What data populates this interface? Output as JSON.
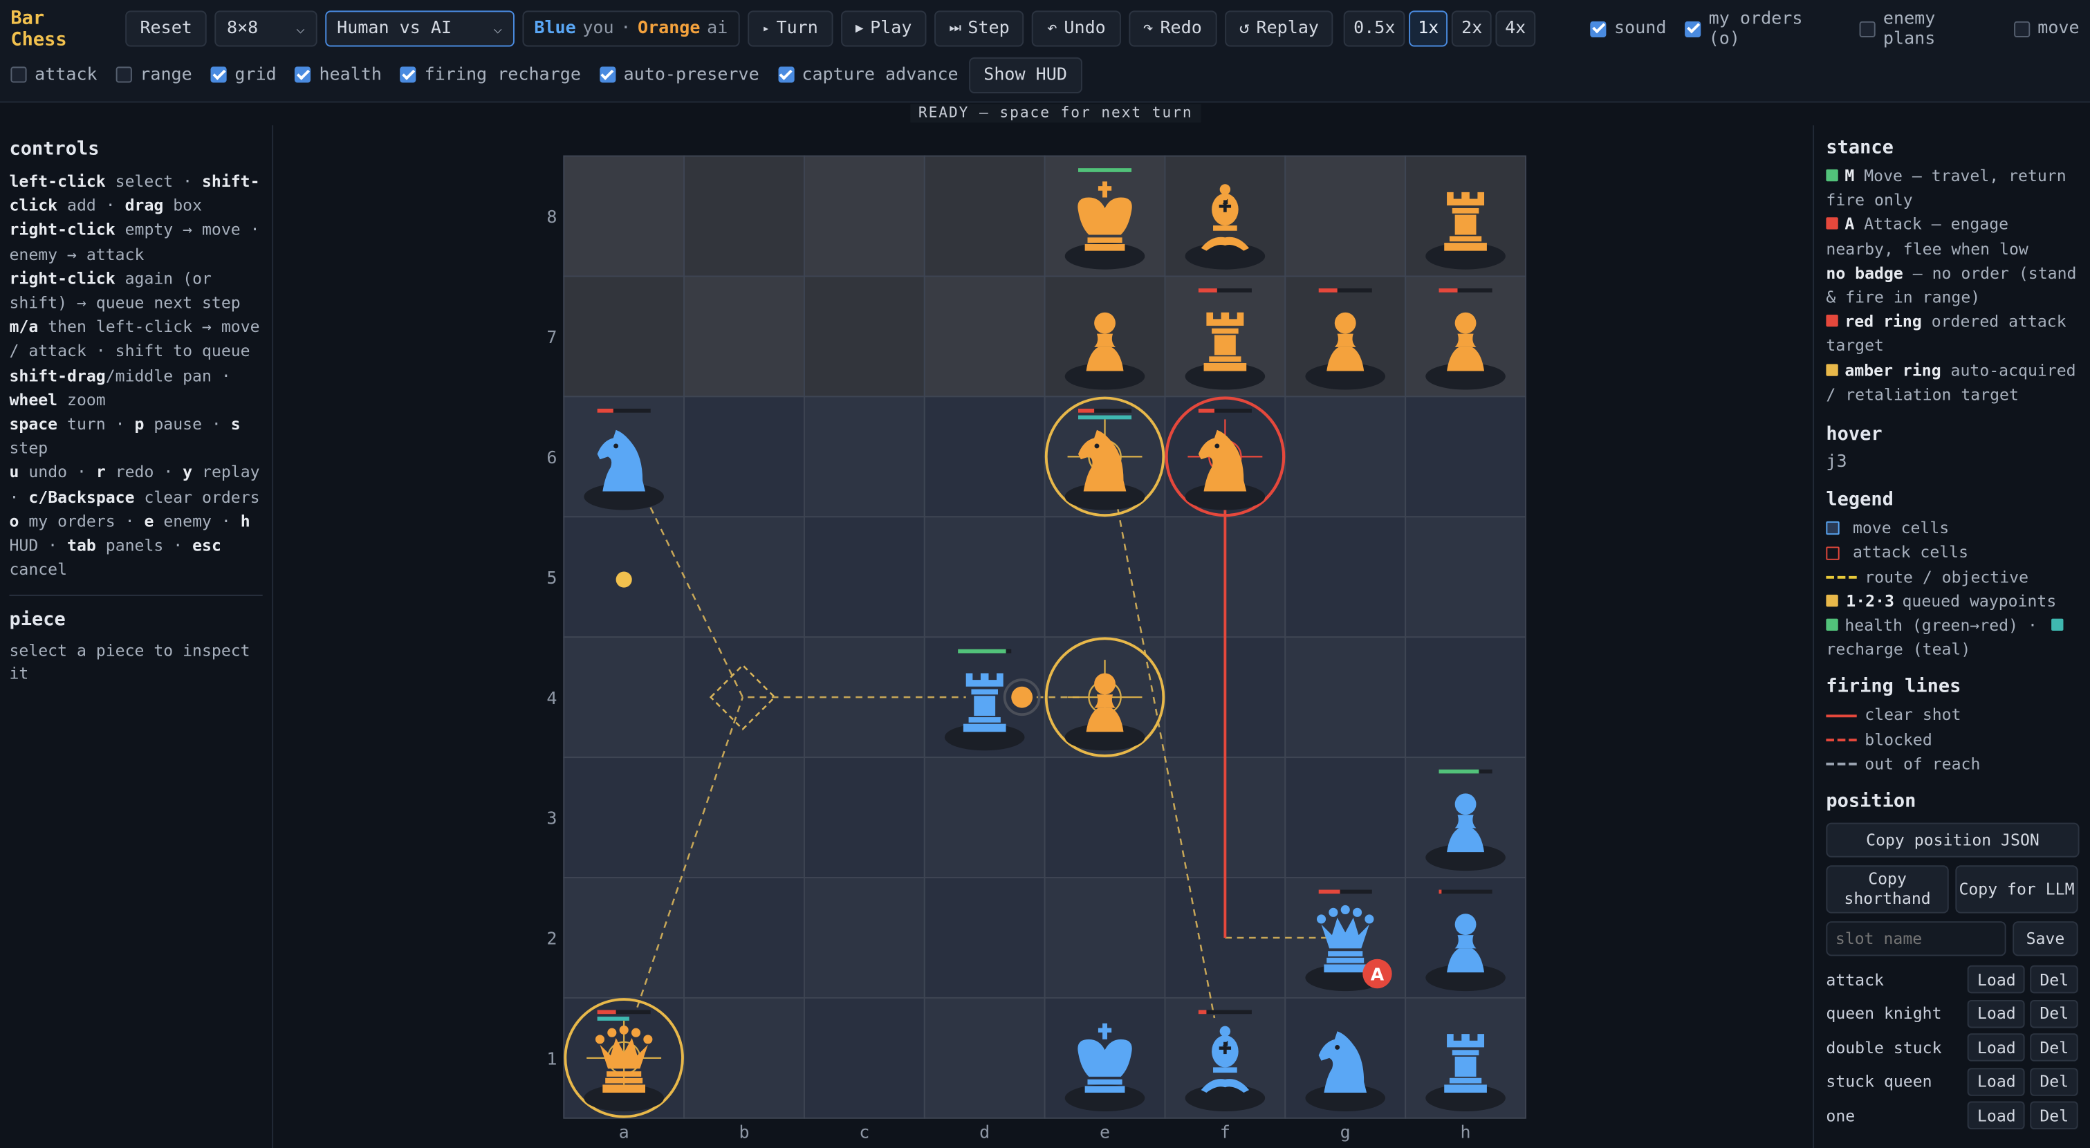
{
  "app": {
    "title": "Bar Chess"
  },
  "toolbar": {
    "reset": "Reset",
    "board_size": "8×8",
    "mode": "Human vs AI",
    "sides": {
      "blue": "Blue",
      "you": "you",
      "dot": "·",
      "orange": "Orange",
      "ai": "ai"
    },
    "turn": "Turn",
    "play": "Play",
    "step": "Step",
    "undo": "Undo",
    "redo": "Redo",
    "replay": "Replay",
    "speeds": [
      "0.5x",
      "1x",
      "2x",
      "4x"
    ],
    "active_speed": "1x",
    "row1_toggles": [
      {
        "label": "sound",
        "checked": true
      },
      {
        "label": "my orders (o)",
        "checked": true
      },
      {
        "label": "enemy plans",
        "checked": false
      },
      {
        "label": "move",
        "checked": false
      }
    ],
    "row2_toggles": [
      {
        "label": "attack",
        "checked": false
      },
      {
        "label": "range",
        "checked": false
      },
      {
        "label": "grid",
        "checked": true
      },
      {
        "label": "health",
        "checked": true
      },
      {
        "label": "firing recharge",
        "checked": true
      },
      {
        "label": "auto-preserve",
        "checked": true
      },
      {
        "label": "capture advance",
        "checked": true
      }
    ],
    "show_hud": "Show HUD",
    "icons": {
      "turn": "triangle-right",
      "play": "play",
      "step": "skip-forward",
      "undo": "undo-arrow",
      "redo": "redo-arrow",
      "replay": "replay-arrow"
    }
  },
  "status": "READY — space for next turn",
  "controls": {
    "title": "controls",
    "lines": [
      [
        {
          "b": "left-click"
        },
        {
          "t": " select · "
        },
        {
          "b": "shift-"
        }
      ],
      [
        {
          "b": "click"
        },
        {
          "t": " add · "
        },
        {
          "b": "drag"
        },
        {
          "t": " box"
        }
      ],
      [
        {
          "b": "right-click"
        },
        {
          "t": " empty → move ·"
        }
      ],
      [
        {
          "t": "enemy → attack"
        }
      ],
      [
        {
          "b": "right-click"
        },
        {
          "t": " again (or"
        }
      ],
      [
        {
          "t": "shift) → queue next step"
        }
      ],
      [
        {
          "b": "m/a"
        },
        {
          "t": " then left-click → move"
        }
      ],
      [
        {
          "t": "/ attack · shift to queue"
        }
      ],
      [
        {
          "b": "shift-drag"
        },
        {
          "t": "/middle pan ·"
        }
      ],
      [
        {
          "b": "wheel"
        },
        {
          "t": " zoom"
        }
      ],
      [
        {
          "b": "space"
        },
        {
          "t": " turn · "
        },
        {
          "b": "p"
        },
        {
          "t": " pause · "
        },
        {
          "b": "s"
        }
      ],
      [
        {
          "t": "step"
        }
      ],
      [
        {
          "b": "u"
        },
        {
          "t": " undo · "
        },
        {
          "b": "r"
        },
        {
          "t": " redo · "
        },
        {
          "b": "y"
        },
        {
          "t": " replay"
        }
      ],
      [
        {
          "t": "· "
        },
        {
          "b": "c/Backspace"
        },
        {
          "t": " clear orders"
        }
      ],
      [
        {
          "b": "o"
        },
        {
          "t": " my orders · "
        },
        {
          "b": "e"
        },
        {
          "t": " enemy · "
        },
        {
          "b": "h"
        }
      ],
      [
        {
          "t": "HUD · "
        },
        {
          "b": "tab"
        },
        {
          "t": " panels · "
        },
        {
          "b": "esc"
        }
      ],
      [
        {
          "t": "cancel"
        }
      ]
    ]
  },
  "piece_panel": {
    "title": "piece",
    "text_1": "select a piece to inspect",
    "text_2": "it"
  },
  "board": {
    "files": [
      "a",
      "b",
      "c",
      "d",
      "e",
      "f",
      "g",
      "h"
    ],
    "ranks": [
      "8",
      "7",
      "6",
      "5",
      "4",
      "3",
      "2",
      "1"
    ],
    "pieces": [
      {
        "color": "orange",
        "type": "king",
        "square": "e8",
        "hp": 1.0,
        "recharge": null
      },
      {
        "color": "orange",
        "type": "bishop",
        "square": "f8",
        "hp": null,
        "recharge": null
      },
      {
        "color": "orange",
        "type": "rook",
        "square": "h8",
        "hp": null,
        "recharge": null
      },
      {
        "color": "orange",
        "type": "pawn",
        "square": "e7",
        "hp": null,
        "recharge": null
      },
      {
        "color": "orange",
        "type": "rook",
        "square": "f7",
        "hp": 0.35,
        "recharge": null
      },
      {
        "color": "orange",
        "type": "pawn",
        "square": "g7",
        "hp": 0.35,
        "recharge": null
      },
      {
        "color": "orange",
        "type": "pawn",
        "square": "h7",
        "hp": 0.35,
        "recharge": null
      },
      {
        "color": "blue",
        "type": "knight",
        "square": "a6",
        "hp": 0.3,
        "recharge": null
      },
      {
        "color": "orange",
        "type": "knight",
        "square": "e6",
        "hp": 0.3,
        "recharge": 1.0
      },
      {
        "color": "orange",
        "type": "knight",
        "square": "f6",
        "hp": 0.3,
        "recharge": null
      },
      {
        "color": "blue",
        "type": "rook",
        "square": "d4",
        "hp": 0.9,
        "recharge": null
      },
      {
        "color": "orange",
        "type": "pawn",
        "square": "e4",
        "hp": null,
        "recharge": null
      },
      {
        "color": "blue",
        "type": "pawn",
        "square": "h3",
        "hp": 0.75,
        "recharge": null
      },
      {
        "color": "blue",
        "type": "queen",
        "square": "g2",
        "hp": 0.4,
        "recharge": null,
        "badge": "A"
      },
      {
        "color": "blue",
        "type": "pawn",
        "square": "h2",
        "hp": 0.05,
        "recharge": null
      },
      {
        "color": "orange",
        "type": "queen",
        "square": "a1",
        "hp": 0.35,
        "recharge": 0.6
      },
      {
        "color": "blue",
        "type": "king",
        "square": "e1",
        "hp": null,
        "recharge": null
      },
      {
        "color": "blue",
        "type": "bishop",
        "square": "f1",
        "hp": 0.15,
        "recharge": null
      },
      {
        "color": "blue",
        "type": "knight",
        "square": "g1",
        "hp": null,
        "recharge": null
      },
      {
        "color": "blue",
        "type": "rook",
        "square": "h1",
        "hp": null,
        "recharge": null
      }
    ],
    "amber_rings": [
      "e6",
      "e4",
      "a1"
    ],
    "red_rings": [
      "f6"
    ],
    "waypoints": [
      "a5",
      "d4"
    ],
    "badge_letter": "A"
  },
  "stance": {
    "title": "stance",
    "items": [
      {
        "color": "#52c27a",
        "key": "M",
        "text": " Move — travel, return fire only"
      },
      {
        "color": "#e5483c",
        "key": "A",
        "text": " Attack — engage nearby, flee when low"
      },
      {
        "color": null,
        "key": "no badge",
        "text": " — no order (stand & fire in range)"
      },
      {
        "color": "#e5483c",
        "key": "red ring",
        "text": " ordered attack target"
      },
      {
        "color": "#e8b84a",
        "key": "amber ring",
        "text": " auto-acquired / retaliation target"
      }
    ]
  },
  "hover": {
    "title": "hover",
    "value": "j3"
  },
  "legend": {
    "title": "legend",
    "move_cells": "move cells",
    "attack_cells": "attack cells",
    "route": "route / objective",
    "queued_key": "1·2·3",
    "queued": "queued waypoints",
    "health": "health (green→red) ·",
    "recharge": "recharge (teal)"
  },
  "firing": {
    "title": "firing lines",
    "clear": "clear shot",
    "blocked": "blocked",
    "out_of_reach": "out of reach"
  },
  "position": {
    "title": "position",
    "copy_json": "Copy position JSON",
    "copy_shorthand": "Copy shorthand",
    "copy_llm": "Copy for LLM",
    "slot_placeholder": "slot name",
    "save": "Save",
    "load": "Load",
    "del": "Del",
    "slots": [
      "attack",
      "queen knight",
      "double stuck",
      "stuck queen",
      "one"
    ]
  },
  "colors": {
    "blue_piece": "#5aa7f5",
    "orange_piece": "#f4a23d",
    "amber": "#e8b84a",
    "red": "#e5483c",
    "health_green": "#52c27a",
    "recharge_teal": "#3fb8b0",
    "title_gold": "#f2c14e"
  }
}
